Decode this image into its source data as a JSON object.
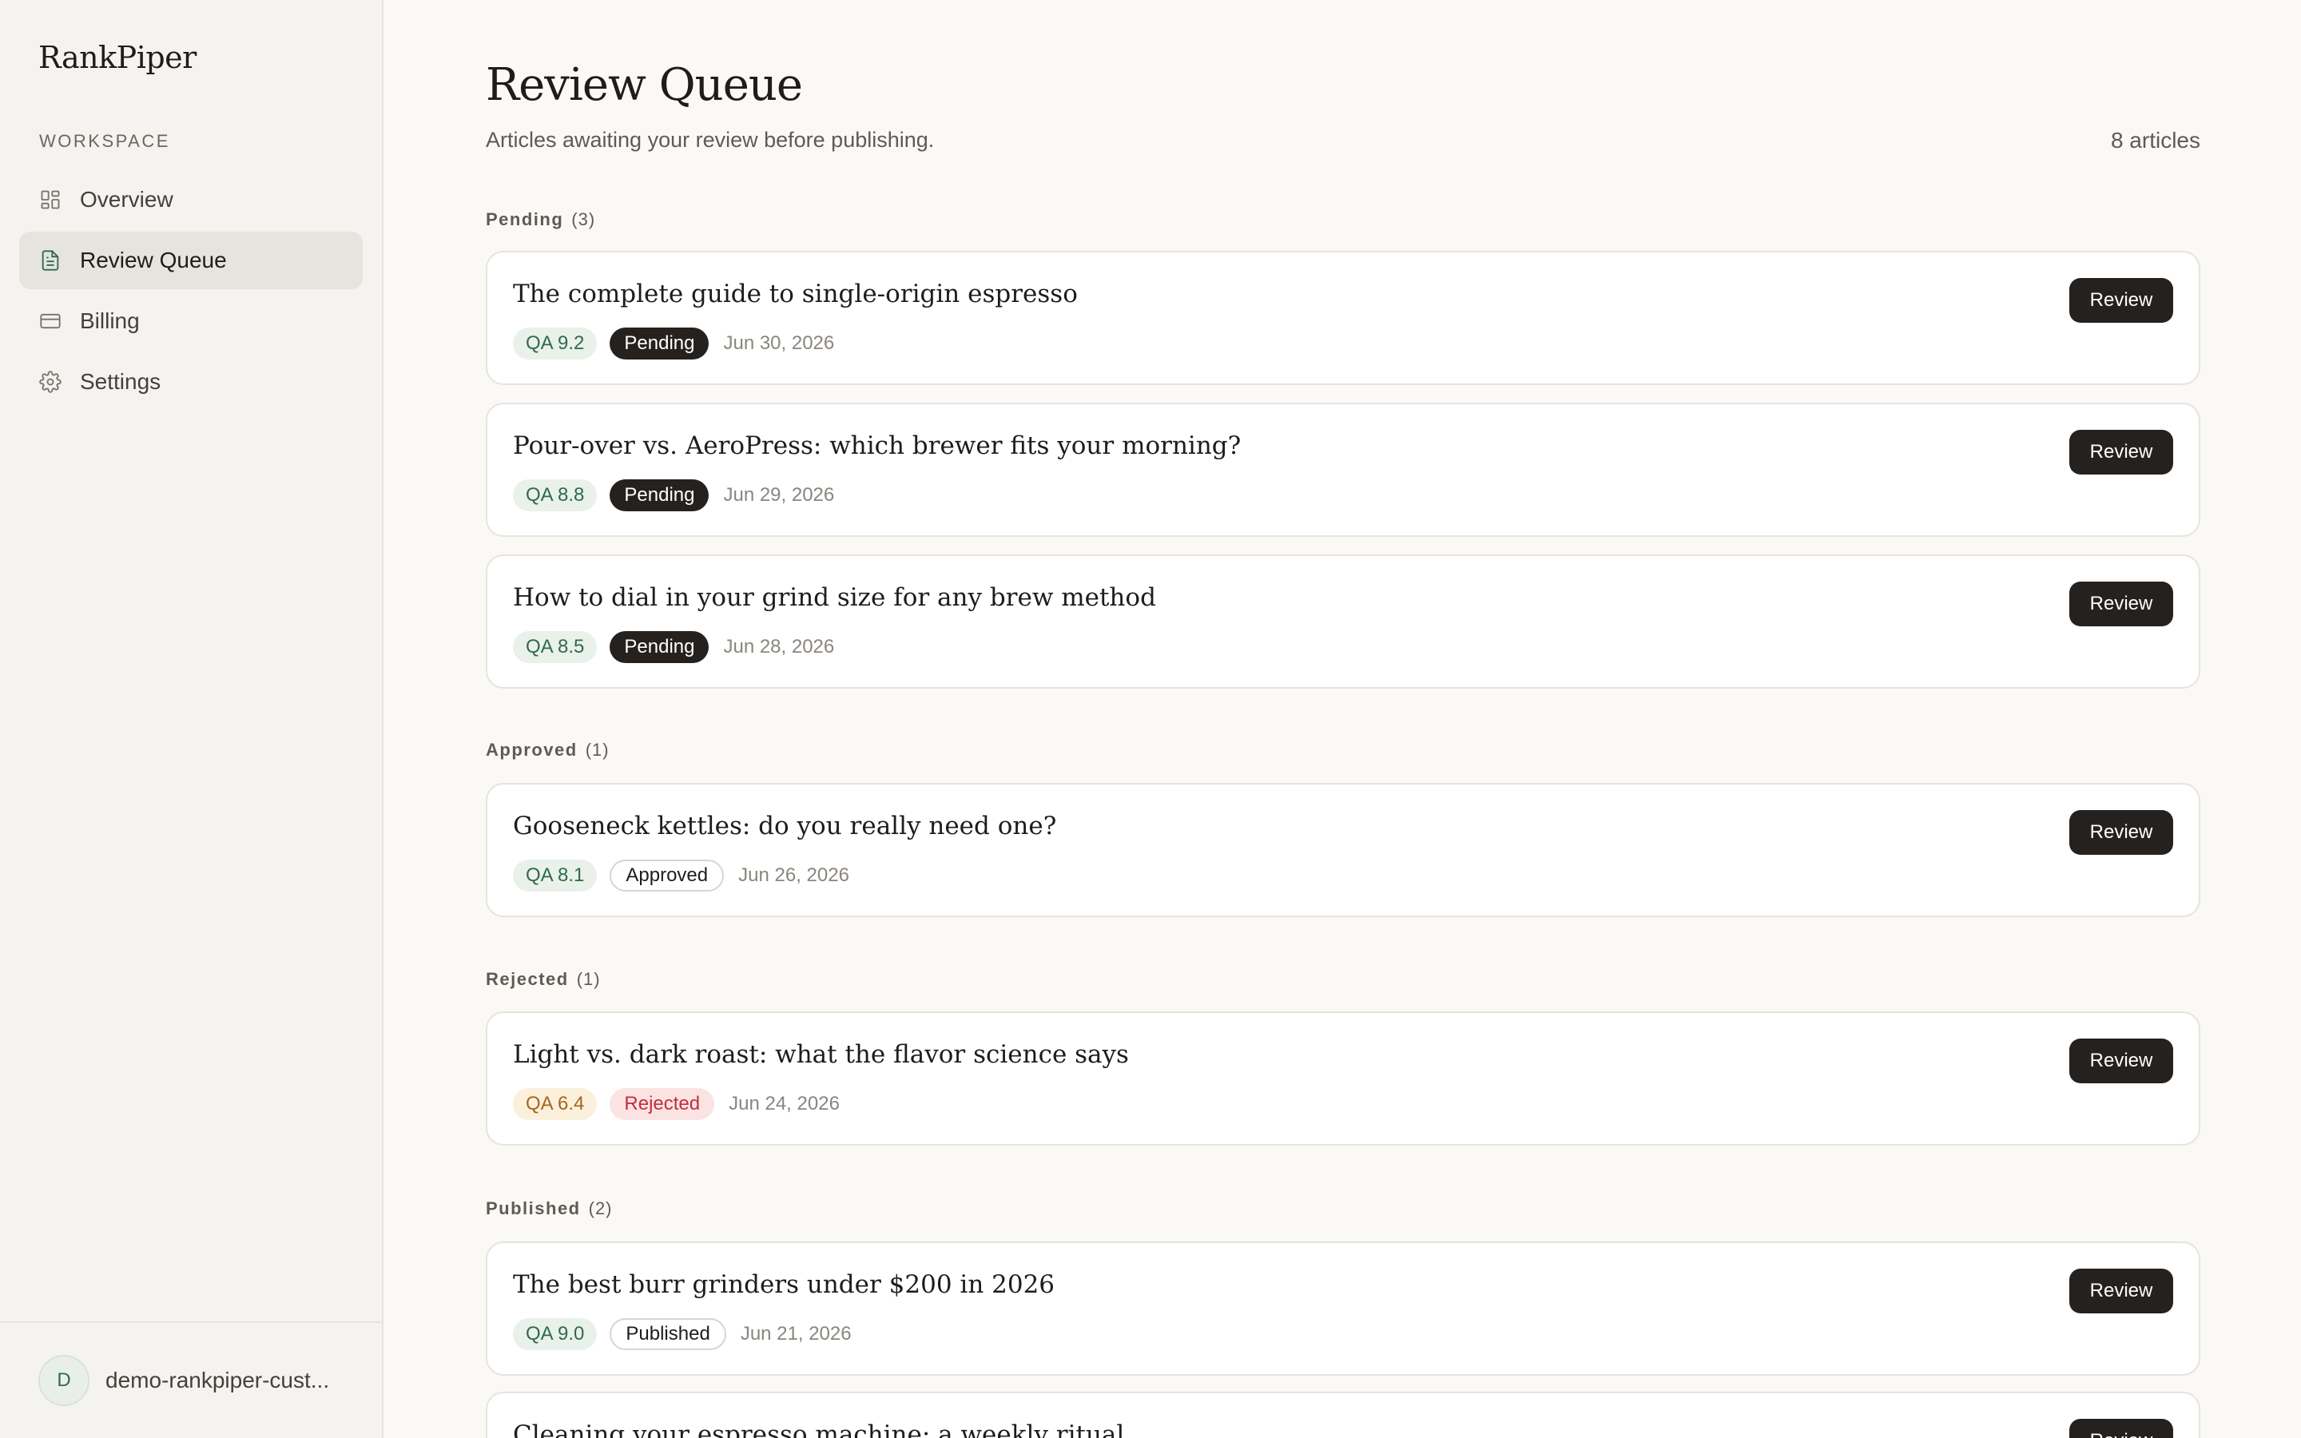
{
  "app": {
    "brand": "RankPiper"
  },
  "sidebar": {
    "section_label": "WORKSPACE",
    "items": [
      {
        "label": "Overview",
        "icon": "grid-icon",
        "active": false
      },
      {
        "label": "Review Queue",
        "icon": "document-icon",
        "active": true
      },
      {
        "label": "Billing",
        "icon": "credit-card-icon",
        "active": false
      },
      {
        "label": "Settings",
        "icon": "gear-icon",
        "active": false
      }
    ],
    "account": {
      "initial": "D",
      "name": "demo-rankpiper-cust..."
    }
  },
  "header": {
    "title": "Review Queue",
    "subtitle": "Articles awaiting your review before publishing.",
    "count": "8 articles"
  },
  "groups": [
    {
      "label": "Pending",
      "count": "(3)",
      "articles": [
        {
          "title": "The complete guide to single-origin espresso",
          "qa": "QA 9.2",
          "status": "Pending",
          "date": "Jun 30, 2026",
          "action": "Review"
        },
        {
          "title": "Pour-over vs. AeroPress: which brewer fits your morning?",
          "qa": "QA 8.8",
          "status": "Pending",
          "date": "Jun 29, 2026",
          "action": "Review"
        },
        {
          "title": "How to dial in your grind size for any brew method",
          "qa": "QA 8.5",
          "status": "Pending",
          "date": "Jun 28, 2026",
          "action": "Review"
        }
      ]
    },
    {
      "label": "Approved",
      "count": "(1)",
      "articles": [
        {
          "title": "Gooseneck kettles: do you really need one?",
          "qa": "QA 8.1",
          "status": "Approved",
          "date": "Jun 26, 2026",
          "action": "Review"
        }
      ]
    },
    {
      "label": "Rejected",
      "count": "(1)",
      "articles": [
        {
          "title": "Light vs. dark roast: what the flavor science says",
          "qa": "QA 6.4",
          "status": "Rejected",
          "date": "Jun 24, 2026",
          "action": "Review"
        }
      ]
    },
    {
      "label": "Published",
      "count": "(2)",
      "articles": [
        {
          "title": "The best burr grinders under $200 in 2026",
          "qa": "QA 9.0",
          "status": "Published",
          "date": "Jun 21, 2026",
          "action": "Review"
        },
        {
          "title": "Cleaning your espresso machine: a weekly ritual",
          "action": "Review"
        }
      ]
    }
  ],
  "colors": {
    "accent": "#2f6b4b",
    "button_dark": "#25211e",
    "qa_good_bg": "#e9f1ea",
    "qa_warn_bg": "#fbf0dc",
    "rejected_bg": "#fbe3e3",
    "rejected_text": "#c0303a"
  }
}
